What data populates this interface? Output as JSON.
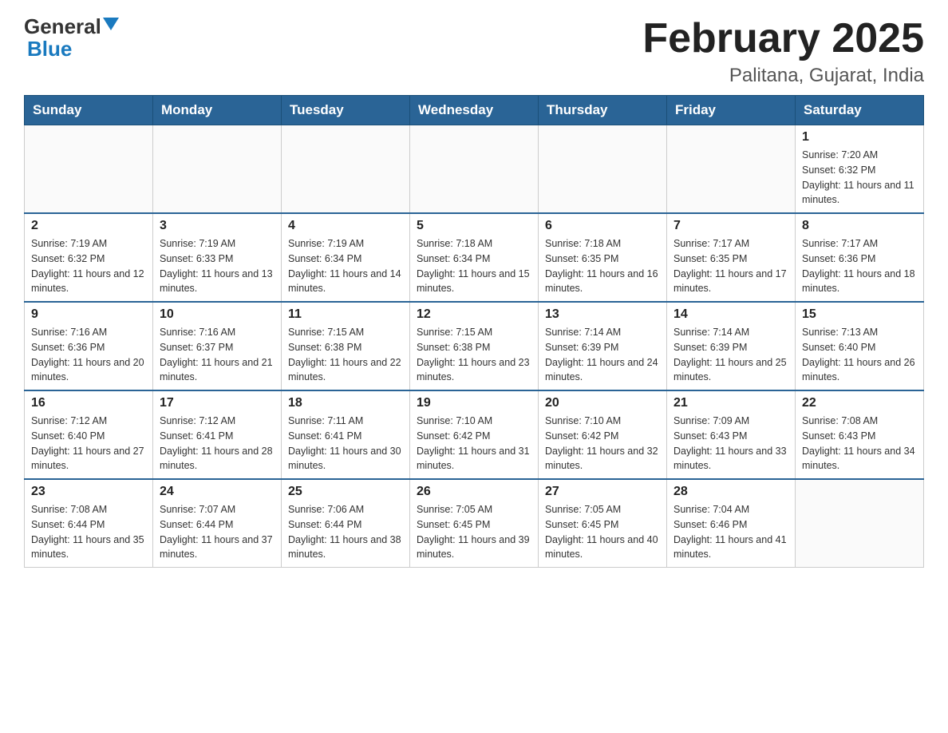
{
  "header": {
    "logo_general": "General",
    "logo_blue": "Blue",
    "month_title": "February 2025",
    "location": "Palitana, Gujarat, India"
  },
  "weekdays": [
    "Sunday",
    "Monday",
    "Tuesday",
    "Wednesday",
    "Thursday",
    "Friday",
    "Saturday"
  ],
  "weeks": [
    [
      {
        "day": "",
        "info": ""
      },
      {
        "day": "",
        "info": ""
      },
      {
        "day": "",
        "info": ""
      },
      {
        "day": "",
        "info": ""
      },
      {
        "day": "",
        "info": ""
      },
      {
        "day": "",
        "info": ""
      },
      {
        "day": "1",
        "info": "Sunrise: 7:20 AM\nSunset: 6:32 PM\nDaylight: 11 hours and 11 minutes."
      }
    ],
    [
      {
        "day": "2",
        "info": "Sunrise: 7:19 AM\nSunset: 6:32 PM\nDaylight: 11 hours and 12 minutes."
      },
      {
        "day": "3",
        "info": "Sunrise: 7:19 AM\nSunset: 6:33 PM\nDaylight: 11 hours and 13 minutes."
      },
      {
        "day": "4",
        "info": "Sunrise: 7:19 AM\nSunset: 6:34 PM\nDaylight: 11 hours and 14 minutes."
      },
      {
        "day": "5",
        "info": "Sunrise: 7:18 AM\nSunset: 6:34 PM\nDaylight: 11 hours and 15 minutes."
      },
      {
        "day": "6",
        "info": "Sunrise: 7:18 AM\nSunset: 6:35 PM\nDaylight: 11 hours and 16 minutes."
      },
      {
        "day": "7",
        "info": "Sunrise: 7:17 AM\nSunset: 6:35 PM\nDaylight: 11 hours and 17 minutes."
      },
      {
        "day": "8",
        "info": "Sunrise: 7:17 AM\nSunset: 6:36 PM\nDaylight: 11 hours and 18 minutes."
      }
    ],
    [
      {
        "day": "9",
        "info": "Sunrise: 7:16 AM\nSunset: 6:36 PM\nDaylight: 11 hours and 20 minutes."
      },
      {
        "day": "10",
        "info": "Sunrise: 7:16 AM\nSunset: 6:37 PM\nDaylight: 11 hours and 21 minutes."
      },
      {
        "day": "11",
        "info": "Sunrise: 7:15 AM\nSunset: 6:38 PM\nDaylight: 11 hours and 22 minutes."
      },
      {
        "day": "12",
        "info": "Sunrise: 7:15 AM\nSunset: 6:38 PM\nDaylight: 11 hours and 23 minutes."
      },
      {
        "day": "13",
        "info": "Sunrise: 7:14 AM\nSunset: 6:39 PM\nDaylight: 11 hours and 24 minutes."
      },
      {
        "day": "14",
        "info": "Sunrise: 7:14 AM\nSunset: 6:39 PM\nDaylight: 11 hours and 25 minutes."
      },
      {
        "day": "15",
        "info": "Sunrise: 7:13 AM\nSunset: 6:40 PM\nDaylight: 11 hours and 26 minutes."
      }
    ],
    [
      {
        "day": "16",
        "info": "Sunrise: 7:12 AM\nSunset: 6:40 PM\nDaylight: 11 hours and 27 minutes."
      },
      {
        "day": "17",
        "info": "Sunrise: 7:12 AM\nSunset: 6:41 PM\nDaylight: 11 hours and 28 minutes."
      },
      {
        "day": "18",
        "info": "Sunrise: 7:11 AM\nSunset: 6:41 PM\nDaylight: 11 hours and 30 minutes."
      },
      {
        "day": "19",
        "info": "Sunrise: 7:10 AM\nSunset: 6:42 PM\nDaylight: 11 hours and 31 minutes."
      },
      {
        "day": "20",
        "info": "Sunrise: 7:10 AM\nSunset: 6:42 PM\nDaylight: 11 hours and 32 minutes."
      },
      {
        "day": "21",
        "info": "Sunrise: 7:09 AM\nSunset: 6:43 PM\nDaylight: 11 hours and 33 minutes."
      },
      {
        "day": "22",
        "info": "Sunrise: 7:08 AM\nSunset: 6:43 PM\nDaylight: 11 hours and 34 minutes."
      }
    ],
    [
      {
        "day": "23",
        "info": "Sunrise: 7:08 AM\nSunset: 6:44 PM\nDaylight: 11 hours and 35 minutes."
      },
      {
        "day": "24",
        "info": "Sunrise: 7:07 AM\nSunset: 6:44 PM\nDaylight: 11 hours and 37 minutes."
      },
      {
        "day": "25",
        "info": "Sunrise: 7:06 AM\nSunset: 6:44 PM\nDaylight: 11 hours and 38 minutes."
      },
      {
        "day": "26",
        "info": "Sunrise: 7:05 AM\nSunset: 6:45 PM\nDaylight: 11 hours and 39 minutes."
      },
      {
        "day": "27",
        "info": "Sunrise: 7:05 AM\nSunset: 6:45 PM\nDaylight: 11 hours and 40 minutes."
      },
      {
        "day": "28",
        "info": "Sunrise: 7:04 AM\nSunset: 6:46 PM\nDaylight: 11 hours and 41 minutes."
      },
      {
        "day": "",
        "info": ""
      }
    ]
  ]
}
